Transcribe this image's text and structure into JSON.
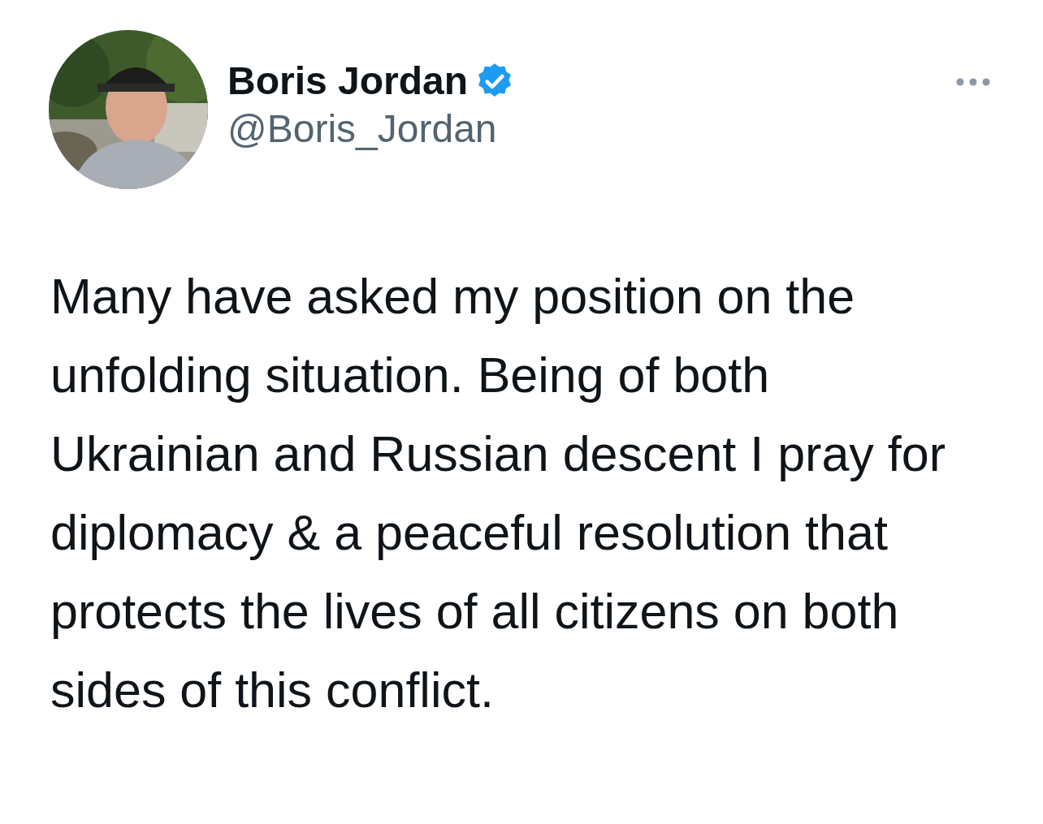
{
  "author": {
    "name": "Boris Jordan",
    "handle": "@Boris_Jordan",
    "verified": true
  },
  "tweet": {
    "text": "Many have asked my position on the unfolding situation. Being of both Ukrainian and Russian descent I pray for diplomacy & a peaceful resolution that protects the lives of all citizens on both sides of this conflict."
  }
}
